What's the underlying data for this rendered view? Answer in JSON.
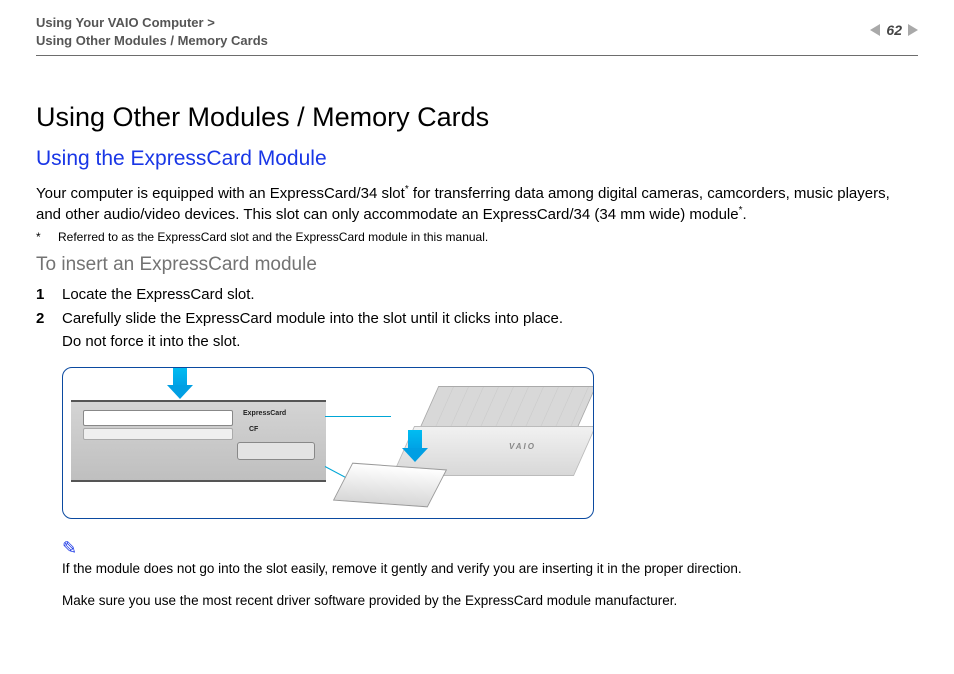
{
  "header": {
    "breadcrumb_line1": "Using Your VAIO Computer",
    "breadcrumb_sep": ">",
    "breadcrumb_line2": "Using Other Modules / Memory Cards",
    "page_number": "62"
  },
  "title": "Using Other Modules / Memory Cards",
  "section_title": "Using the ExpressCard Module",
  "intro": "Your computer is equipped with an ExpressCard/34 slot",
  "intro_cont": " for transferring data among digital cameras, camcorders, music players, and other audio/video devices. This slot can only accommodate an ExpressCard/34 (34 mm wide) module",
  "intro_end": ".",
  "footnote_marker": "*",
  "footnote_text": "Referred to as the ExpressCard slot and the ExpressCard module in this manual.",
  "subsection_title": "To insert an ExpressCard module",
  "steps": [
    {
      "num": "1",
      "text": "Locate the ExpressCard slot."
    },
    {
      "num": "2",
      "text": "Carefully slide the ExpressCard module into the slot until it clicks into place.",
      "text2": "Do not force it into the slot."
    }
  ],
  "figure": {
    "expresscard_label": "ExpressCard",
    "cf_label": "CF",
    "brand": "VAIO"
  },
  "note_icon": "✎",
  "note1": "If the module does not go into the slot easily, remove it gently and verify you are inserting it in the proper direction.",
  "note2": "Make sure you use the most recent driver software provided by the ExpressCard module manufacturer."
}
